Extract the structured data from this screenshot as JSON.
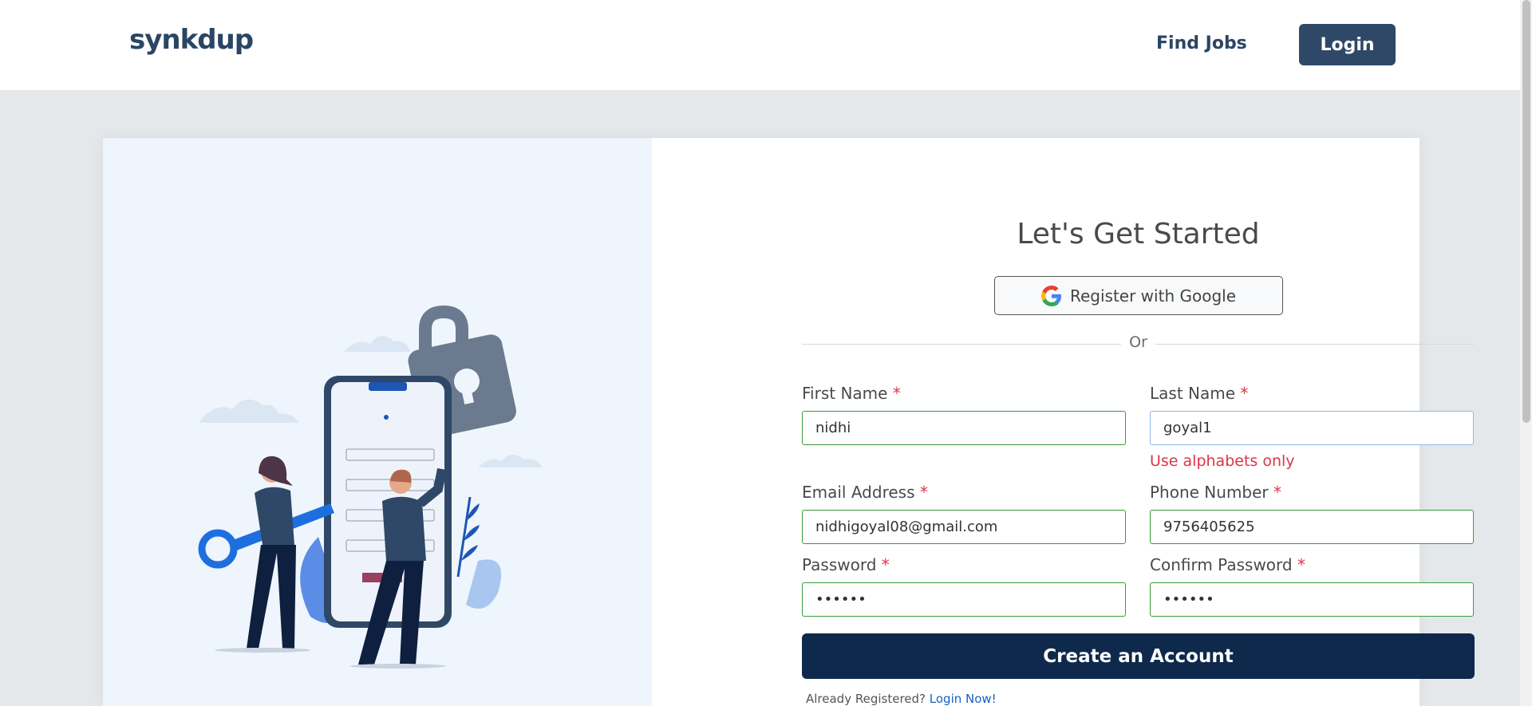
{
  "header": {
    "logo": "synkdup",
    "nav_find_jobs": "Find Jobs",
    "nav_login": "Login"
  },
  "form": {
    "title": "Let's Get Started",
    "google_label": "Register with Google",
    "or_label": "Or",
    "first_name": {
      "label": "First Name",
      "required_mark": "*",
      "value": "nidhi"
    },
    "last_name": {
      "label": "Last Name",
      "required_mark": "*",
      "value": "goyal1",
      "error": "Use alphabets only"
    },
    "email": {
      "label": "Email Address",
      "required_mark": "*",
      "value": "nidhigoyal08@gmail.com"
    },
    "phone": {
      "label": "Phone Number",
      "required_mark": "*",
      "value": "9756405625"
    },
    "password": {
      "label": "Password",
      "required_mark": "*",
      "value": "••••••"
    },
    "confirm_password": {
      "label": "Confirm Password",
      "required_mark": "*",
      "value": "••••••"
    },
    "create_button": "Create an Account",
    "already_text": "Already Registered?",
    "login_now": "Login Now!"
  },
  "colors": {
    "brand_dark": "#0e294b",
    "valid_border": "#3a9a3a",
    "error": "#dc3545",
    "link": "#1a5fc8"
  }
}
